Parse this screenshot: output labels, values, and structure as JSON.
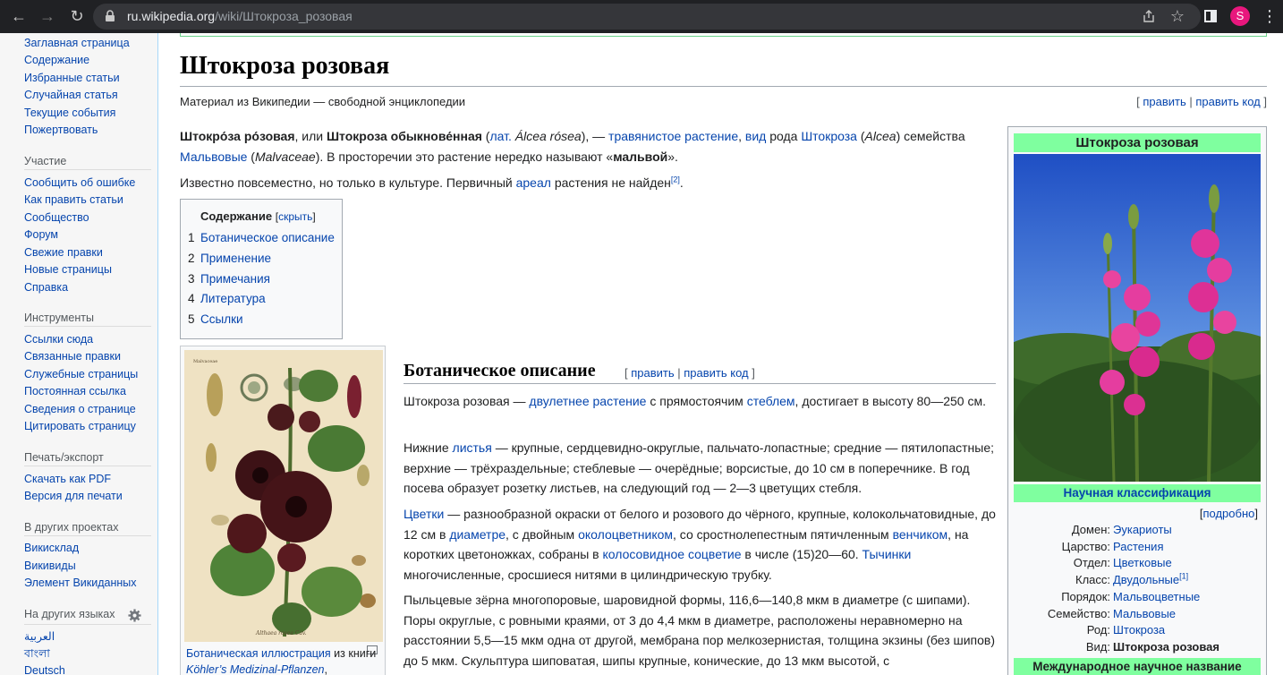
{
  "browser": {
    "url_host": "ru.wikipedia.org",
    "url_path": "/wiki/Штокроза_розовая",
    "profile_initial": "S"
  },
  "sidebar": {
    "main_links": [
      "Заглавная страница",
      "Содержание",
      "Избранные статьи",
      "Случайная статья",
      "Текущие события",
      "Пожертвовать"
    ],
    "participation": {
      "heading": "Участие",
      "links": [
        "Сообщить об ошибке",
        "Как править статьи",
        "Сообщество",
        "Форум",
        "Свежие правки",
        "Новые страницы",
        "Справка"
      ]
    },
    "tools": {
      "heading": "Инструменты",
      "links": [
        "Ссылки сюда",
        "Связанные правки",
        "Служебные страницы",
        "Постоянная ссылка",
        "Сведения о странице",
        "Цитировать страницу"
      ]
    },
    "print": {
      "heading": "Печать/экспорт",
      "links": [
        "Скачать как PDF",
        "Версия для печати"
      ]
    },
    "projects": {
      "heading": "В других проектах",
      "links": [
        "Викисклад",
        "Викивиды",
        "Элемент Викиданных"
      ]
    },
    "languages": {
      "heading": "На других языках",
      "links": [
        "العربية",
        "বাংলা",
        "Deutsch"
      ]
    }
  },
  "article": {
    "title": "Штокроза розовая",
    "tagline": "Материал из Википедии — свободной энциклопедии",
    "edit": "править",
    "edit_code": "править код",
    "intro1": {
      "b1": "Штокро́за ро́зовая",
      "t1": ", или ",
      "b2": "Штокроза обыкнове́нная",
      "t2": " (",
      "l1": "лат.",
      "t3": " ",
      "i1": "Álcea rósea",
      "t4": "), — ",
      "l2": "травянистое растение",
      "t5": ", ",
      "l3": "вид",
      "t6": " рода ",
      "l4": "Штокроза",
      "t7": " (",
      "i2": "Alcea",
      "t8": ") семейства ",
      "l5": "Мальвовые",
      "t9": " (",
      "i3": "Malvaceae",
      "t10": "). В просторечии это растение нередко называют «",
      "b3": "мальвой",
      "t11": "»."
    },
    "intro2": {
      "t1": "Известно повсеместно, но только в культуре. Первичный ",
      "l1": "ареал",
      "t2": " растения не найден",
      "sup": "[2]",
      "t3": "."
    },
    "toc": {
      "title": "Содержание",
      "hide": "скрыть",
      "items": [
        {
          "num": "1",
          "text": "Ботаническое описание"
        },
        {
          "num": "2",
          "text": "Применение"
        },
        {
          "num": "3",
          "text": "Примечания"
        },
        {
          "num": "4",
          "text": "Литература"
        },
        {
          "num": "5",
          "text": "Ссылки"
        }
      ]
    },
    "thumb": {
      "caption_link": "Ботаническая иллюстрация",
      "caption_t1": " из книги ",
      "caption_i": "Köhler’s Medizinal-Pflanzen",
      "caption_t2": ","
    },
    "section1": {
      "heading": "Ботаническое описание",
      "p1": {
        "t1": "Штокроза розовая — ",
        "l1": "двулетнее растение",
        "t2": " с прямостоячим ",
        "l2": "стеблем",
        "t3": ", достигает в высоту 80—250 см."
      },
      "p2": {
        "t1": "Нижние ",
        "l1": "листья",
        "t2": " — крупные, сердцевидно-округлые, пальчато-лопастные; средние — пятилопастные; верхние — трёхраздельные; стеблевые — очерёдные; ворсистые, до 10 см в поперечнике. В год посева образует розетку листьев, на следующий год — 2—3 цветущих стебля."
      },
      "p3": {
        "l1": "Цветки",
        "t1": " — разнообразной окраски от белого и розового до чёрного, крупные, колокольчатовидные, до 12 см в ",
        "l2": "диаметре",
        "t2": ", с двойным ",
        "l3": "околоцветником",
        "t3": ", со сростнолепестным пятичленным ",
        "l4": "венчиком",
        "t4": ", на коротких цветоножках, собраны в ",
        "l5": "колосовидное соцветие",
        "t5": " в числе (15)20—60. ",
        "l6": "Тычинки",
        "t6": " многочисленные, сросшиеся нитями в цилиндрическую трубку."
      },
      "p4": {
        "t1": "Пыльцевые зёрна многопоровые, шаровидной формы, 116,6—140,8 мкм в диаметре (с шипами). Поры округлые, с ровными краями, от 3 до 4,4 мкм в диаметре, расположены неравномерно на расстоянии 5,5—15 мкм одна от другой, мембрана пор мелкозернистая, толщина экзины (без шипов) до 5 мкм. Скульптура шиповатая, шипы крупные, конические, до 13 мкм высотой, с"
      }
    }
  },
  "infobox": {
    "title": "Штокроза розовая",
    "classification_title": "Научная классификация",
    "detail": "подробно",
    "rows": [
      {
        "label": "Домен:",
        "value": "Эукариоты"
      },
      {
        "label": "Царство:",
        "value": "Растения"
      },
      {
        "label": "Отдел:",
        "value": "Цветковые"
      },
      {
        "label": "Класс:",
        "value": "Двудольные",
        "sup": "[1]"
      },
      {
        "label": "Порядок:",
        "value": "Мальвоцветные"
      },
      {
        "label": "Семейство:",
        "value": "Мальвовые"
      },
      {
        "label": "Род:",
        "value": "Штокроза"
      },
      {
        "label": "Вид:",
        "value": "Штокроза розовая"
      }
    ],
    "intl_title": "Международное научное название"
  },
  "colors": {
    "link": "#0645ad",
    "infobox_header": "#7fff9f",
    "sidebar_bg": "#f6f6f6",
    "chrome_bg": "#202124",
    "profile": "#e8177d"
  }
}
